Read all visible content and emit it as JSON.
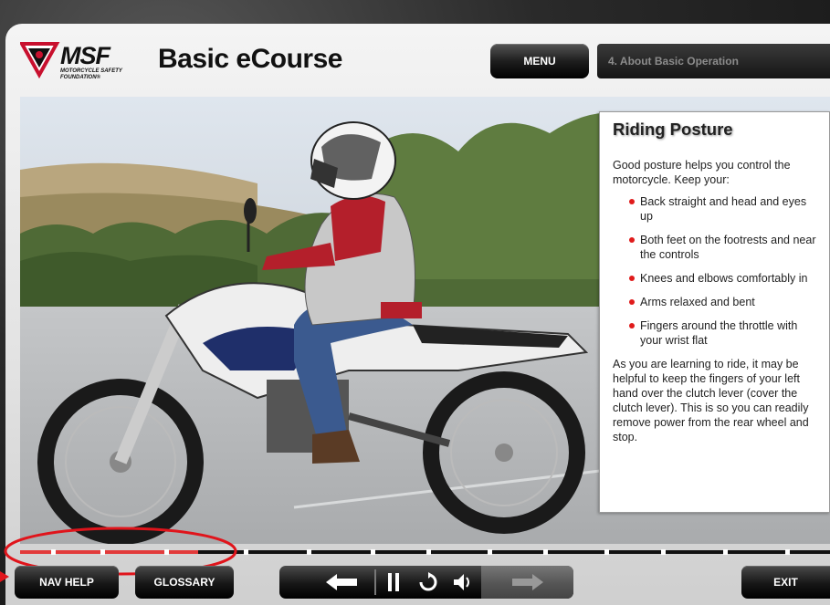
{
  "header": {
    "logo_text": "MSF",
    "logo_subtitle": "MOTORCYCLE SAFETY FOUNDATION®",
    "app_title": "Basic eCourse",
    "menu_label": "MENU",
    "section_label": "4. About Basic Operation"
  },
  "panel": {
    "title": "Riding Posture",
    "intro": "Good posture helps you control the motorcycle.  Keep your:",
    "items": [
      "Back straight and head and eyes up",
      "Both feet on the footrests and near the controls",
      "Knees and elbows comfortably in",
      "Arms relaxed and bent",
      "Fingers around the throttle with your wrist flat"
    ],
    "outro": "As you are learning to ride, it may be helpful to keep the fingers of your left hand over the clutch lever (cover the clutch lever).  This is so you can readily remove power from the rear wheel and stop."
  },
  "footer": {
    "nav_help_label": "NAV HELP",
    "glossary_label": "GLOSSARY",
    "exit_label": "EXIT",
    "controls": [
      "back-arrow-icon",
      "pause-icon",
      "replay-icon",
      "audio-icon",
      "next-arrow-icon"
    ]
  },
  "progress": {
    "completed_fraction": 0.22
  },
  "colors": {
    "accent_red": "#e01b1b",
    "button_dark": "#1e1e1e",
    "section_text": "#8c8c8c"
  }
}
